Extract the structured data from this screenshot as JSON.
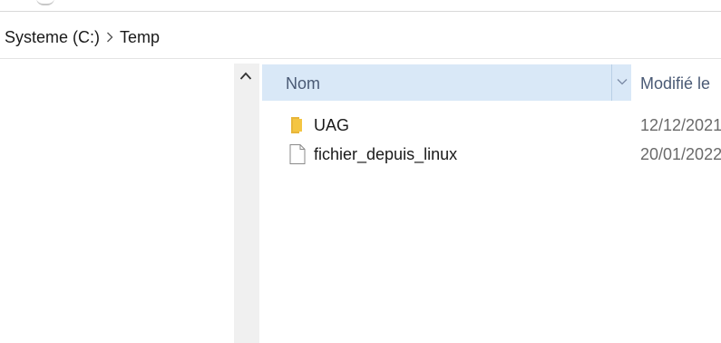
{
  "address_bar": {
    "crumbs": [
      "Systeme (C:)",
      "Temp"
    ]
  },
  "column_headers": {
    "name": "Nom",
    "modified": "Modifié le"
  },
  "files": [
    {
      "icon": "folder-icon",
      "name": "UAG",
      "modified": "12/12/2021"
    },
    {
      "icon": "file-icon",
      "name": "fichier_depuis_linux",
      "modified": "20/01/2022"
    }
  ],
  "colors": {
    "header_bg": "#d9e8f7",
    "header_text": "#4a5a75",
    "folder": "#f4c542",
    "scrollbar": "#f0f0f0"
  }
}
